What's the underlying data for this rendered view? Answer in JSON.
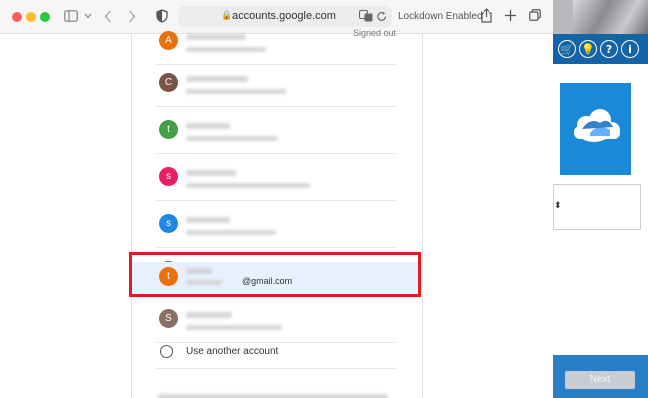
{
  "browser": {
    "url": "accounts.google.com",
    "lockdown_label": "Lockdown Enabled"
  },
  "accounts": [
    {
      "initial": "A",
      "color": "#e8710a",
      "status": "Signed out"
    },
    {
      "initial": "C",
      "color": "#795548"
    },
    {
      "initial": "t",
      "color": "#43a047"
    },
    {
      "initial": "s",
      "color": "#e91e63"
    },
    {
      "initial": "s",
      "color": "#1e88e5"
    },
    {
      "initial": "",
      "color": "#6d8a3a"
    },
    {
      "initial": "t",
      "color": "#e8710a",
      "email_suffix": "@gmail.com",
      "selected": true
    },
    {
      "initial": "S",
      "color": "#8d6e63"
    }
  ],
  "use_another_label": "Use another account",
  "bg_app": {
    "icons": [
      "🛒",
      "💡",
      "?",
      "i"
    ],
    "select_arrow": "⬍",
    "next_label": "Next"
  }
}
